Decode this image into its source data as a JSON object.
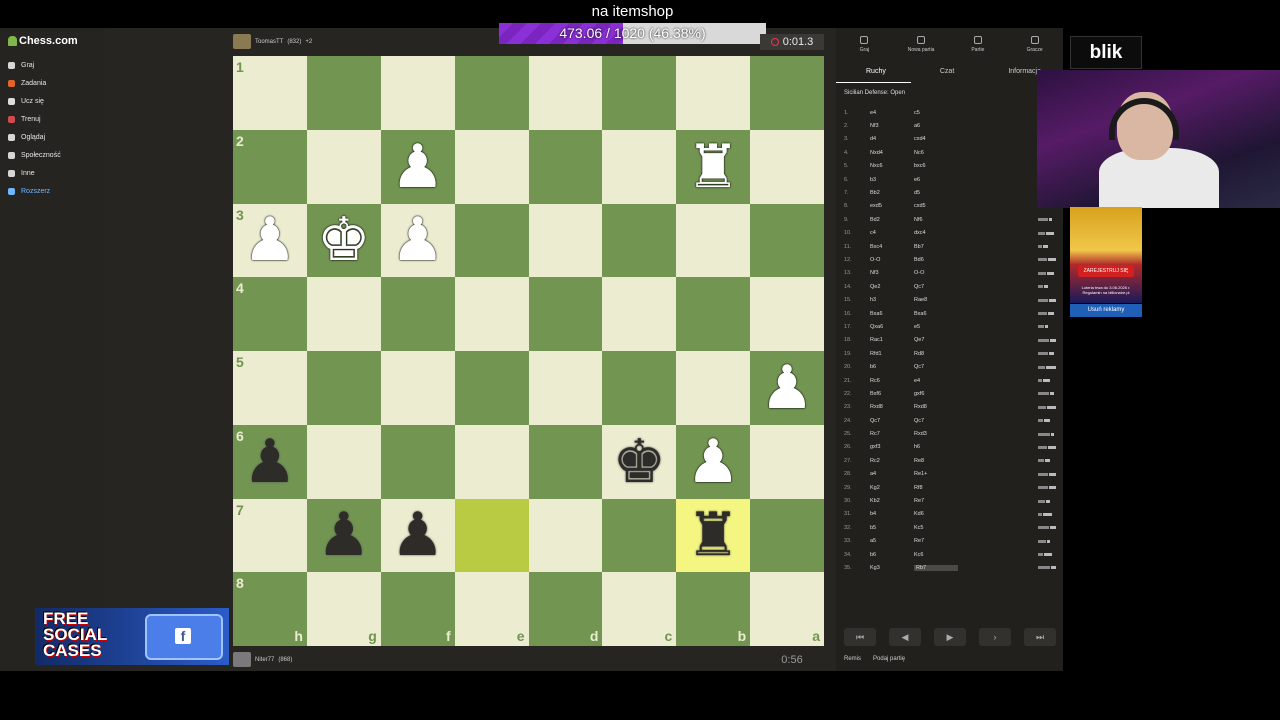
{
  "overlay": {
    "goal_title": "na itemshop",
    "goal_progress_text": "473.06 / 1020 (46.38%)",
    "goal_fraction": 0.4638
  },
  "sidebar": {
    "logo": "Chess.com",
    "items": [
      {
        "label": "Graj",
        "color": "#d6d6d6"
      },
      {
        "label": "Zadania",
        "color": "#e3642a"
      },
      {
        "label": "Ucz się",
        "color": "#ddd"
      },
      {
        "label": "Trenuj",
        "color": "#d04b4b"
      },
      {
        "label": "Oglądaj",
        "color": "#d6d6d6"
      },
      {
        "label": "Społeczność",
        "color": "#d6d6d6"
      },
      {
        "label": "Inne",
        "color": "#d6d6d6"
      },
      {
        "label": "Rozszerz",
        "color": "#6fb7ff"
      }
    ]
  },
  "players": {
    "top": {
      "name": "ToomasTT",
      "rating": "(832)",
      "extra": "+2"
    },
    "bottom": {
      "name": "Niter77",
      "rating": "(868)"
    }
  },
  "clocks": {
    "top": "0:01.3",
    "bottom": "0:56"
  },
  "board": {
    "orientation": "black",
    "ranks": [
      "1",
      "2",
      "3",
      "4",
      "5",
      "6",
      "7",
      "8"
    ],
    "files": [
      "h",
      "g",
      "f",
      "e",
      "d",
      "c",
      "b",
      "a"
    ],
    "highlight": [
      "e7",
      "b7"
    ],
    "pieces": {
      "f2": "wP",
      "b2": "wR",
      "h3": "wP",
      "g3": "wK",
      "f3": "wP",
      "a5": "wP",
      "h6": "bP",
      "c6": "bK",
      "b6": "wP",
      "g7": "bP",
      "f7": "bP",
      "b7": "bR"
    }
  },
  "panel": {
    "tabs": [
      "Graj",
      "Nowa partia",
      "Partie",
      "Gracze"
    ],
    "subtabs": [
      "Ruchy",
      "Czat",
      "Informacje"
    ],
    "opening": "Sicilian Defense: Open",
    "moves": [
      [
        "1.",
        "e4",
        "c5"
      ],
      [
        "2.",
        "Nf3",
        "a6"
      ],
      [
        "3.",
        "d4",
        "cxd4"
      ],
      [
        "4.",
        "Nxd4",
        "Nc6"
      ],
      [
        "5.",
        "Nxc6",
        "bxc6"
      ],
      [
        "6.",
        "b3",
        "e6"
      ],
      [
        "7.",
        "Bb2",
        "d5"
      ],
      [
        "8.",
        "exd5",
        "cxd5"
      ],
      [
        "9.",
        "Bd2",
        "Nf6"
      ],
      [
        "10.",
        "c4",
        "dxc4"
      ],
      [
        "11.",
        "Bxc4",
        "Bb7"
      ],
      [
        "12.",
        "O-O",
        "Bd6"
      ],
      [
        "13.",
        "Nf3",
        "O-O"
      ],
      [
        "14.",
        "Qe2",
        "Qc7"
      ],
      [
        "15.",
        "h3",
        "Rae8"
      ],
      [
        "16.",
        "Bxa6",
        "Bxa6"
      ],
      [
        "17.",
        "Qxa6",
        "e5"
      ],
      [
        "18.",
        "Rac1",
        "Qe7"
      ],
      [
        "19.",
        "Rfd1",
        "Rd8"
      ],
      [
        "20.",
        "b6",
        "Qc7"
      ],
      [
        "21.",
        "Rc6",
        "e4"
      ],
      [
        "22.",
        "Bxf6",
        "gxf6"
      ],
      [
        "23.",
        "Rxd8",
        "Rxd8"
      ],
      [
        "24.",
        "Qc7",
        "Qc7"
      ],
      [
        "25.",
        "Rc7",
        "Rxd3"
      ],
      [
        "26.",
        "gxf3",
        "h6"
      ],
      [
        "27.",
        "Rc2",
        "Re8"
      ],
      [
        "28.",
        "a4",
        "Re1+"
      ],
      [
        "29.",
        "Kg2",
        "Rf8"
      ],
      [
        "30.",
        "Kb2",
        "Re7"
      ],
      [
        "31.",
        "b4",
        "Kd6"
      ],
      [
        "32.",
        "b5",
        "Kc5"
      ],
      [
        "33.",
        "a5",
        "Re7"
      ],
      [
        "34.",
        "b6",
        "Kc6"
      ],
      [
        "35.",
        "Kg3",
        "Rb7"
      ]
    ],
    "nav": [
      "⏮",
      "◀",
      "▶",
      "›",
      "⏭"
    ],
    "footer": [
      "Remis",
      "Podaj partię"
    ]
  },
  "ads": {
    "blik": "blik",
    "promo_button": "ZAREJESTRUJ SIĘ",
    "promo_small": "Loteria trwa do 3.06.2026 r. Regulamin na billionaire.pl",
    "remove_ads": "Usuń reklamy"
  },
  "promo": {
    "text": "FREE SOCIAL CASES"
  }
}
